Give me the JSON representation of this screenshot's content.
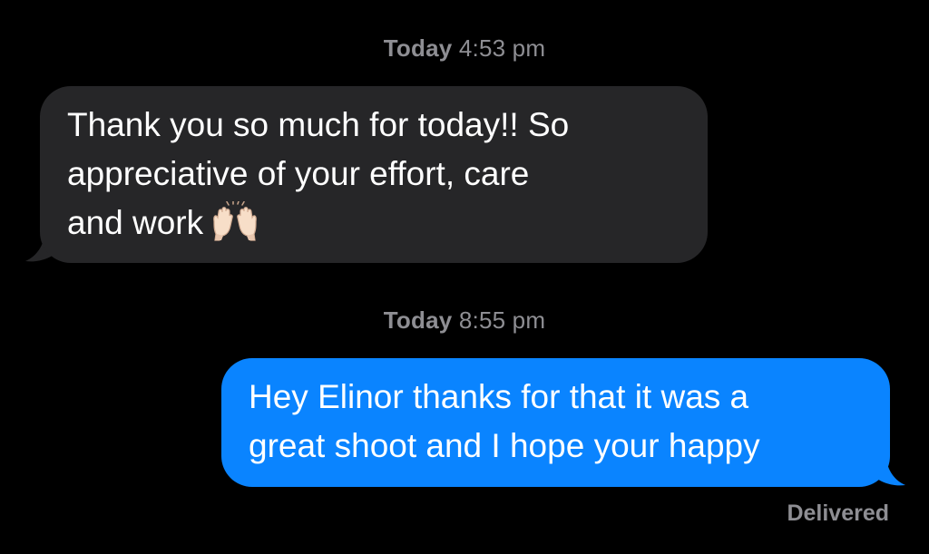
{
  "thread": {
    "timestamp_1": {
      "day": "Today",
      "time": "4:53 pm"
    },
    "incoming_message": {
      "lines": [
        "Thank you so much for today!! So",
        "appreciative of your effort, care",
        "and work"
      ],
      "emoji": "raised-hands-emoji"
    },
    "timestamp_2": {
      "day": "Today",
      "time": "8:55 pm"
    },
    "outgoing_message": {
      "lines": [
        "Hey Elinor thanks for that it was a",
        "great shoot and I hope your happy"
      ]
    },
    "status": "Delivered"
  },
  "colors": {
    "background": "#000000",
    "incoming_bubble": "#262628",
    "outgoing_bubble": "#0a84ff",
    "meta_text": "#8e8e93",
    "message_text": "#ffffff"
  }
}
